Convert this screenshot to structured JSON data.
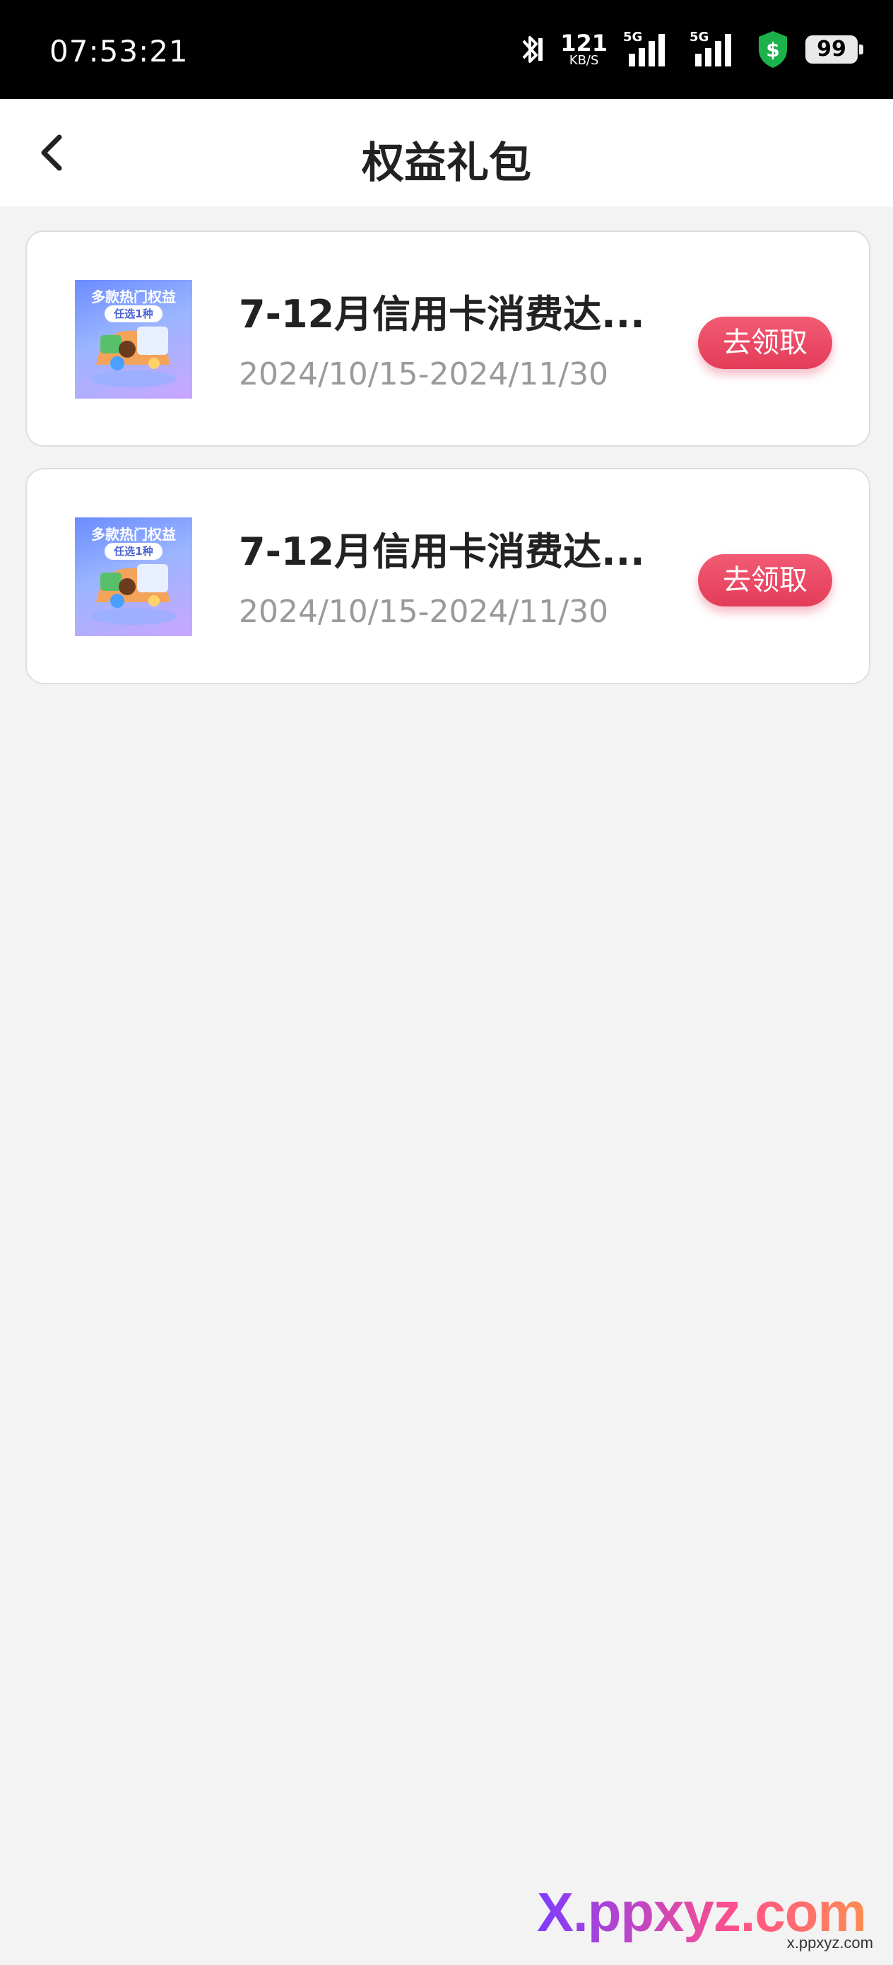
{
  "status_bar": {
    "time": "07:53:21",
    "net_speed_value": "121",
    "net_speed_unit": "KB/S",
    "signal1_label": "5G",
    "signal2_label": "5G",
    "battery": "99"
  },
  "header": {
    "title": "权益礼包"
  },
  "packages": [
    {
      "thumb_title": "多款热门权益",
      "thumb_badge": "任选1种",
      "title": "7-12月信用卡消费达...",
      "date_range": "2024/10/15-2024/11/30",
      "button_label": "去领取"
    },
    {
      "thumb_title": "多款热门权益",
      "thumb_badge": "任选1种",
      "title": "7-12月信用卡消费达...",
      "date_range": "2024/10/15-2024/11/30",
      "button_label": "去领取"
    }
  ],
  "watermark": {
    "main": "X.ppxyz.com",
    "sub": "x.ppxyz.com"
  },
  "colors": {
    "accent": "#e84863",
    "background": "#f3f3f3"
  }
}
